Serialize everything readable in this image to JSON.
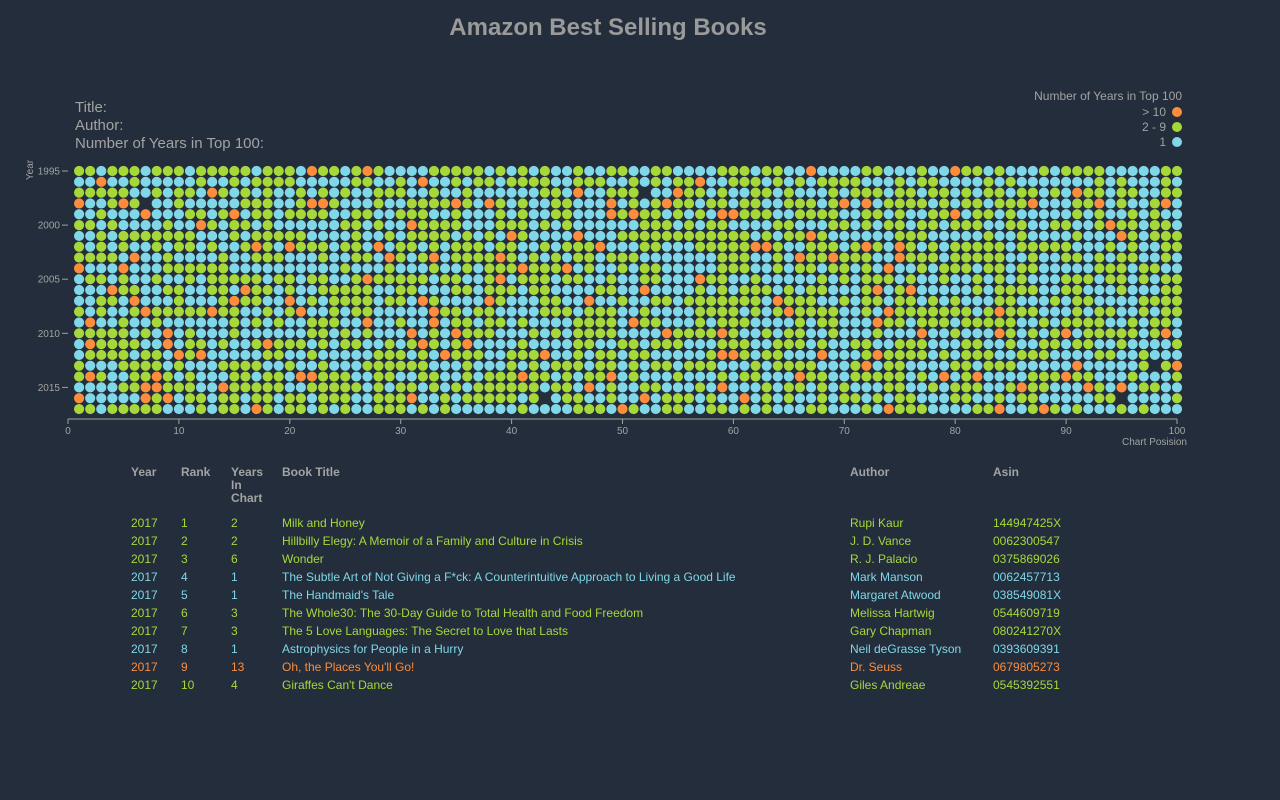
{
  "page": {
    "title": "Amazon Best Selling Books"
  },
  "info_panel": {
    "title_label": "Title:",
    "author_label": "Author:",
    "years_label": "Number of Years in Top 100:"
  },
  "legend": {
    "title": "Number of Years in Top 100",
    "items": [
      {
        "label": "> 10",
        "color": "#fd8d3c"
      },
      {
        "label": "2 - 9",
        "color": "#a6d83a"
      },
      {
        "label": "1",
        "color": "#7fd7e8"
      }
    ]
  },
  "colors": {
    "background": "#232d3b",
    "gt10": "#fd8d3c",
    "range2to9": "#a6d83a",
    "one": "#7fd7e8",
    "axis": "#a3a3a3"
  },
  "chart_data": {
    "type": "scatter",
    "xlabel": "Chart Posision",
    "ylabel": "Year",
    "xlim": [
      0,
      100
    ],
    "ylim": [
      1995,
      2017
    ],
    "x_ticks": [
      0,
      10,
      20,
      30,
      40,
      50,
      60,
      70,
      80,
      90,
      100
    ],
    "y_ticks": [
      1995,
      2000,
      2005,
      2010,
      2015
    ],
    "categories": [
      "1",
      "2 - 9",
      "> 10"
    ],
    "grid": false,
    "legend_position": "top-right",
    "note_missing_cells": [
      [
        7,
        1998
      ],
      [
        52,
        1997
      ],
      [
        43,
        2016
      ],
      [
        95,
        2016
      ],
      [
        98,
        2013
      ]
    ]
  },
  "table": {
    "headers": {
      "year": "Year",
      "rank": "Rank",
      "years_line1": "Years",
      "years_line2": "In Chart",
      "title": "Book Title",
      "author": "Author",
      "asin": "Asin"
    },
    "rows": [
      {
        "year": "2017",
        "rank": "1",
        "years": "2",
        "title": "Milk and Honey",
        "author": "Rupi Kaur",
        "asin": "144947425X"
      },
      {
        "year": "2017",
        "rank": "2",
        "years": "2",
        "title": "Hillbilly Elegy: A Memoir of a Family and Culture in Crisis",
        "author": "J. D. Vance",
        "asin": "0062300547"
      },
      {
        "year": "2017",
        "rank": "3",
        "years": "6",
        "title": "Wonder",
        "author": "R. J. Palacio",
        "asin": "0375869026"
      },
      {
        "year": "2017",
        "rank": "4",
        "years": "1",
        "title": "The Subtle Art of Not Giving a F*ck: A Counterintuitive Approach to Living a Good Life",
        "author": "Mark Manson",
        "asin": "0062457713"
      },
      {
        "year": "2017",
        "rank": "5",
        "years": "1",
        "title": "The Handmaid's Tale",
        "author": "Margaret Atwood",
        "asin": "038549081X"
      },
      {
        "year": "2017",
        "rank": "6",
        "years": "3",
        "title": "The Whole30: The 30-Day Guide to Total Health and Food Freedom",
        "author": "Melissa Hartwig",
        "asin": "0544609719"
      },
      {
        "year": "2017",
        "rank": "7",
        "years": "3",
        "title": "The 5 Love Languages: The Secret to Love that Lasts",
        "author": "Gary Chapman",
        "asin": "080241270X"
      },
      {
        "year": "2017",
        "rank": "8",
        "years": "1",
        "title": "Astrophysics for People in a Hurry",
        "author": "Neil deGrasse Tyson",
        "asin": "0393609391"
      },
      {
        "year": "2017",
        "rank": "9",
        "years": "13",
        "title": "Oh, the Places You'll Go!",
        "author": "Dr. Seuss",
        "asin": "0679805273"
      },
      {
        "year": "2017",
        "rank": "10",
        "years": "4",
        "title": "Giraffes Can't Dance",
        "author": "Giles Andreae",
        "asin": "0545392551"
      }
    ]
  }
}
